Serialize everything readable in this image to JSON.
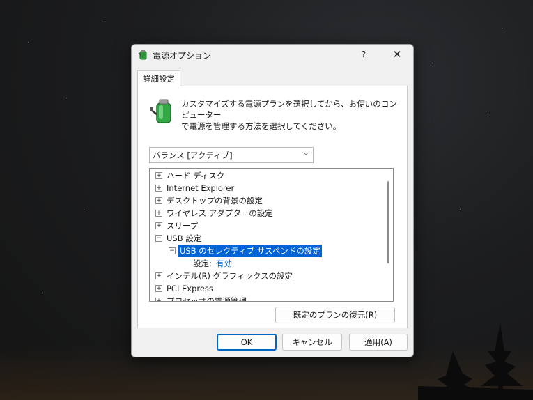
{
  "window": {
    "title": "電源オプション",
    "help": "?",
    "close": "✕"
  },
  "tab": {
    "label": "詳細設定"
  },
  "description": "カスタマイズする電源プランを選択してから、お使いのコンピューター\nで電源を管理する方法を選択してください。",
  "plan": {
    "selected": "バランス [アクティブ]"
  },
  "tree": {
    "items": [
      {
        "label": "ハード ディスク",
        "expander": "+"
      },
      {
        "label": "Internet Explorer",
        "expander": "+"
      },
      {
        "label": "デスクトップの背景の設定",
        "expander": "+"
      },
      {
        "label": "ワイヤレス アダプターの設定",
        "expander": "+"
      },
      {
        "label": "スリープ",
        "expander": "+"
      },
      {
        "label": "USB 設定",
        "expander": "−"
      },
      {
        "label": "USB のセレクティブ サスペンドの設定",
        "expander": "−"
      },
      {
        "label": "設定:",
        "value": "有効"
      },
      {
        "label": "インテル(R) グラフィックスの設定",
        "expander": "+"
      },
      {
        "label": "PCI Express",
        "expander": "+"
      },
      {
        "label": "プロセッサの電源管理",
        "expander": "+"
      }
    ]
  },
  "buttons": {
    "restore": "既定のプランの復元(R)",
    "ok": "OK",
    "cancel": "キャンセル",
    "apply": "適用(A)"
  },
  "colors": {
    "selection": "#0063d6",
    "link": "#0063c9",
    "primary_border": "#0067c0"
  }
}
